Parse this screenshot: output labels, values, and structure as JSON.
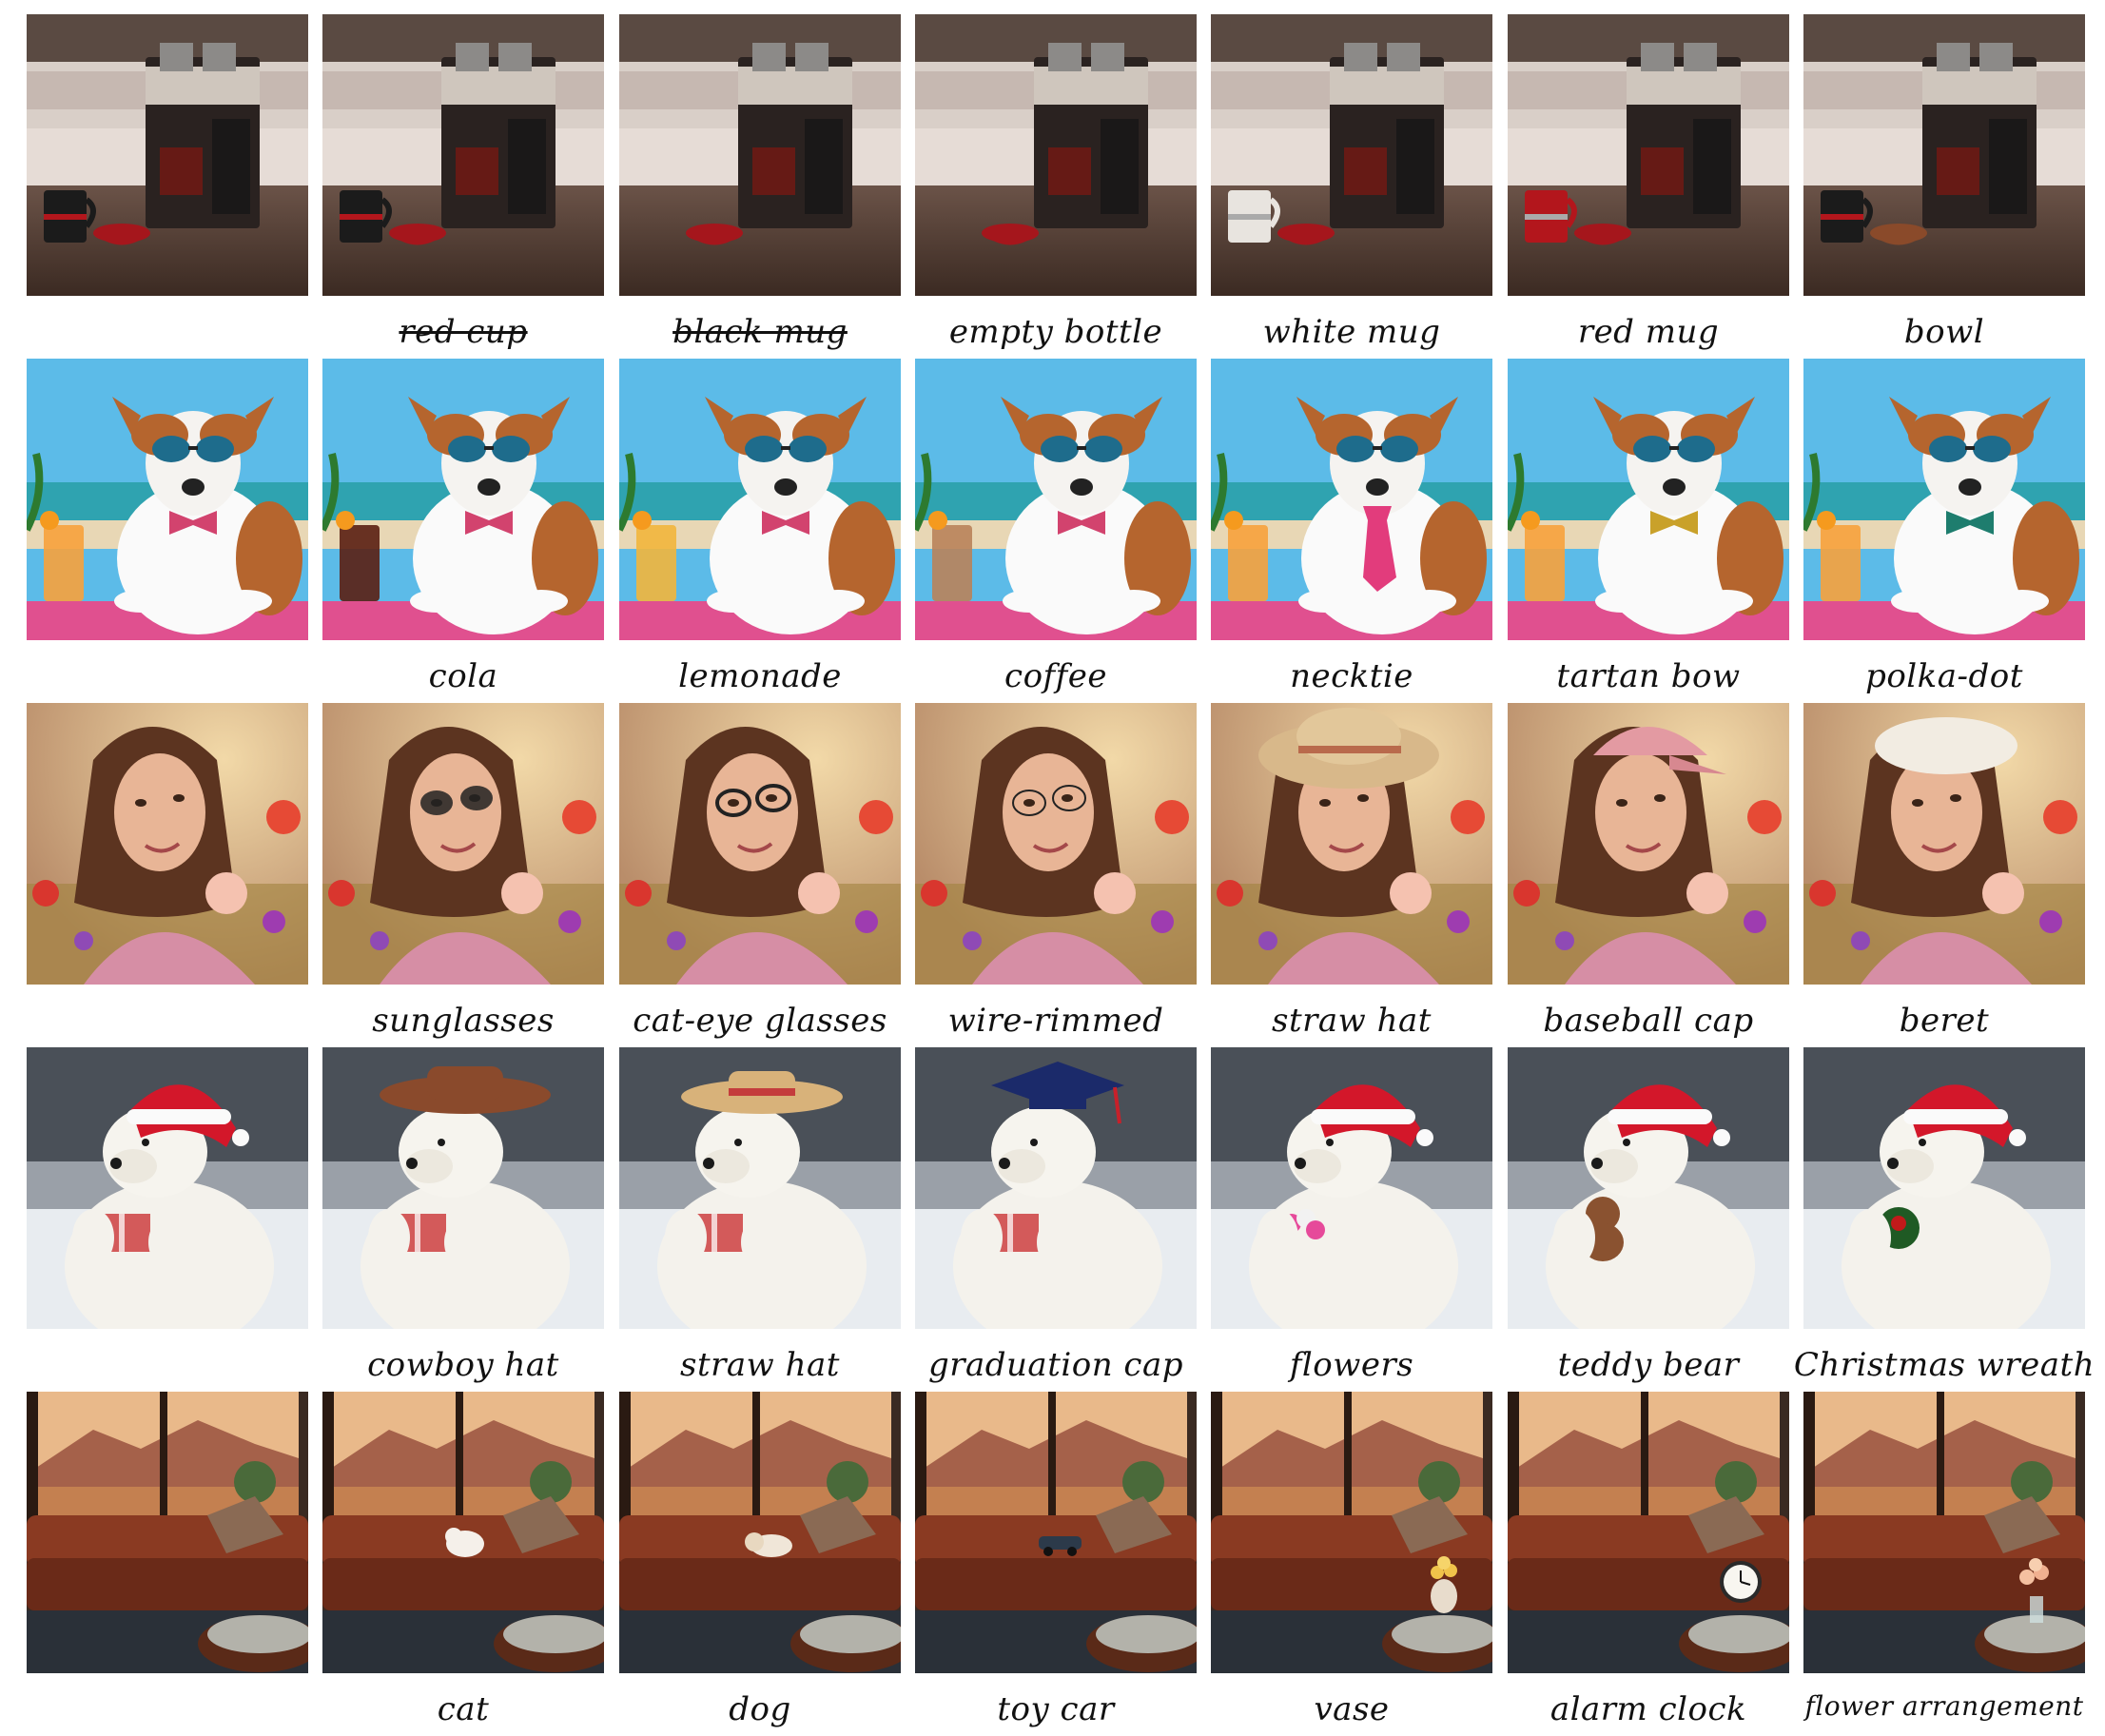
{
  "rows": [
    {
      "scene": "kitchen-coffee",
      "captions": [
        "",
        "red cup",
        "black mug",
        "empty bottle",
        "white mug",
        "red mug",
        "bowl"
      ],
      "struck": [
        false,
        true,
        true,
        false,
        false,
        false,
        false
      ]
    },
    {
      "scene": "beach-dog",
      "captions": [
        "",
        "cola",
        "lemonade",
        "coffee",
        "necktie",
        "tartan bow",
        "polka-dot"
      ],
      "struck": [
        false,
        false,
        false,
        false,
        false,
        false,
        false
      ]
    },
    {
      "scene": "flower-field-woman",
      "captions": [
        "",
        "sunglasses",
        "cat-eye glasses",
        "wire-rimmed",
        "straw hat",
        "baseball cap",
        "beret"
      ],
      "struck": [
        false,
        false,
        false,
        false,
        false,
        false,
        false
      ]
    },
    {
      "scene": "polar-bear",
      "captions": [
        "",
        "cowboy hat",
        "straw hat",
        "graduation cap",
        "flowers",
        "teddy bear",
        "Christmas wreath"
      ],
      "struck": [
        false,
        false,
        false,
        false,
        false,
        false,
        false
      ]
    },
    {
      "scene": "living-room-sofa",
      "captions": [
        "",
        "cat",
        "dog",
        "toy car",
        "vase",
        "alarm clock",
        "flower arrangement"
      ],
      "struck": [
        false,
        false,
        false,
        false,
        false,
        false,
        false
      ]
    }
  ]
}
